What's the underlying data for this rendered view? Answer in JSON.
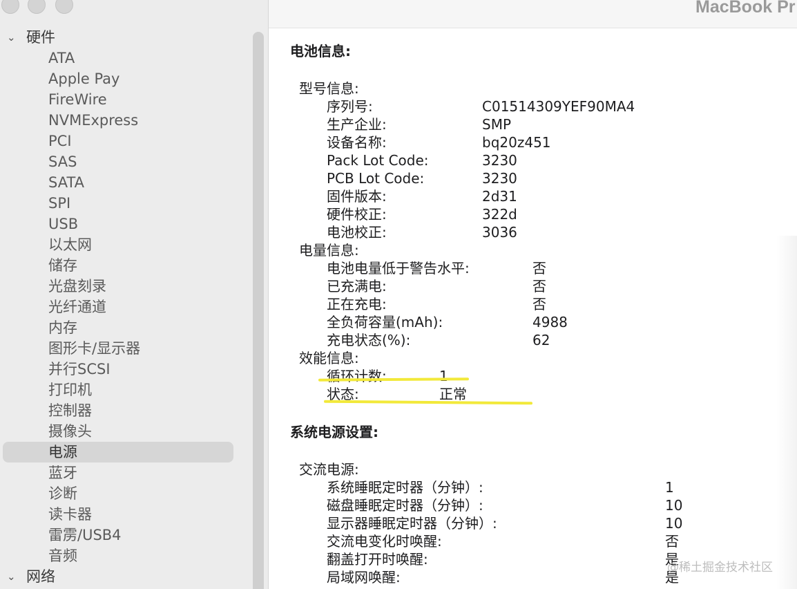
{
  "window": {
    "title": "MacBook Pr"
  },
  "sidebar": {
    "sections": [
      {
        "label": "硬件"
      },
      {
        "label": "网络"
      }
    ],
    "items": [
      {
        "label": "ATA"
      },
      {
        "label": "Apple Pay"
      },
      {
        "label": "FireWire"
      },
      {
        "label": "NVMExpress"
      },
      {
        "label": "PCI"
      },
      {
        "label": "SAS"
      },
      {
        "label": "SATA"
      },
      {
        "label": "SPI"
      },
      {
        "label": "USB"
      },
      {
        "label": "以太网"
      },
      {
        "label": "储存"
      },
      {
        "label": "光盘刻录"
      },
      {
        "label": "光纤通道"
      },
      {
        "label": "内存"
      },
      {
        "label": "图形卡/显示器"
      },
      {
        "label": "并行SCSI"
      },
      {
        "label": "打印机"
      },
      {
        "label": "控制器"
      },
      {
        "label": "摄像头"
      },
      {
        "label": "电源",
        "selected": true
      },
      {
        "label": "蓝牙"
      },
      {
        "label": "诊断"
      },
      {
        "label": "读卡器"
      },
      {
        "label": "雷雳/USB4"
      },
      {
        "label": "音频"
      }
    ]
  },
  "battery": {
    "heading": "电池信息:",
    "model": {
      "label": "型号信息:",
      "rows": [
        {
          "label": "序列号:",
          "value": "C01514309YEF90MA4"
        },
        {
          "label": "生产企业:",
          "value": "SMP"
        },
        {
          "label": "设备名称:",
          "value": "bq20z451"
        },
        {
          "label": "Pack Lot Code:",
          "value": "3230"
        },
        {
          "label": "PCB Lot Code:",
          "value": "3230"
        },
        {
          "label": "固件版本:",
          "value": "2d31"
        },
        {
          "label": "硬件校正:",
          "value": "322d"
        },
        {
          "label": "电池校正:",
          "value": "3036"
        }
      ]
    },
    "charge": {
      "label": "电量信息:",
      "rows": [
        {
          "label": "电池电量低于警告水平:",
          "value": "否"
        },
        {
          "label": "已充满电:",
          "value": "否"
        },
        {
          "label": "正在充电:",
          "value": "否"
        },
        {
          "label": "全负荷容量(mAh):",
          "value": "4988"
        },
        {
          "label": "充电状态(%):",
          "value": "62"
        }
      ]
    },
    "health": {
      "label": "效能信息:",
      "rows": [
        {
          "label": "循环计数:",
          "value": "1"
        },
        {
          "label": "状态:",
          "value": "正常"
        }
      ]
    }
  },
  "power": {
    "heading": "系统电源设置:",
    "ac": {
      "label": "交流电源:",
      "rows": [
        {
          "label": "系统睡眠定时器（分钟）:",
          "value": "1"
        },
        {
          "label": "磁盘睡眠定时器（分钟）:",
          "value": "10"
        },
        {
          "label": "显示器睡眠定时器（分钟）:",
          "value": "10"
        },
        {
          "label": "交流电变化时唤醒:",
          "value": "否"
        },
        {
          "label": "翻盖打开时唤醒:",
          "value": "是"
        },
        {
          "label": "局域网唤醒:",
          "value": "是"
        }
      ]
    }
  },
  "watermark": "@稀土掘金技术社区",
  "colors": {
    "highlight": "#f2e93a",
    "selected_bg": "#d6d6d6",
    "sidebar_bg": "#ececec"
  }
}
